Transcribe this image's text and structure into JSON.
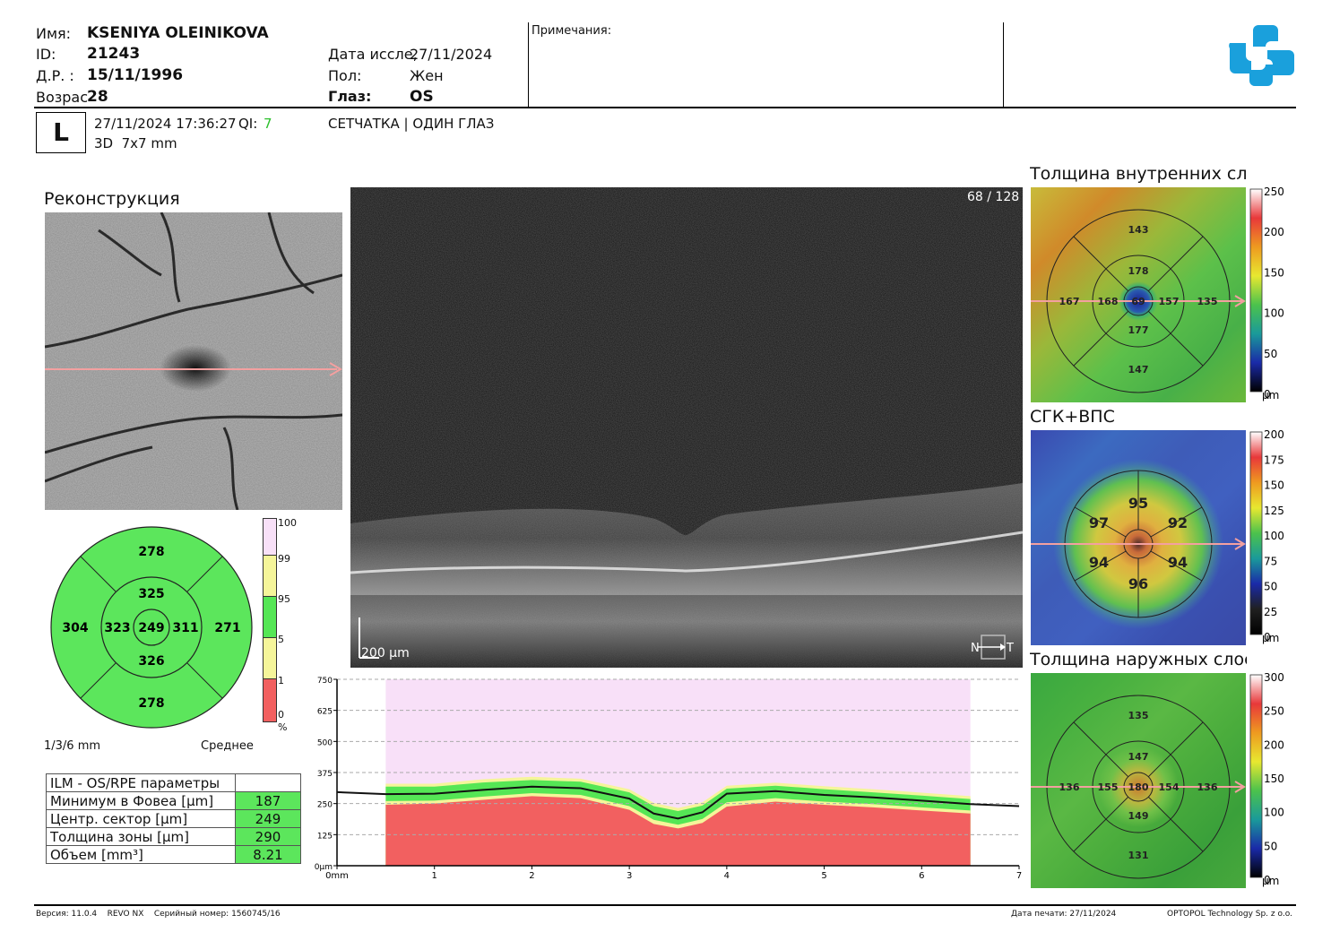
{
  "patient": {
    "name_label": "Имя:",
    "name": "KSENIYA OLEINIKOVA",
    "id_label": "ID:",
    "id": "21243",
    "dob_label": "Д.Р. :",
    "dob": "15/11/1996",
    "age_label": "Возрас",
    "age": "28",
    "exam_label": "Дата иссле,",
    "exam_date": "27/11/2024",
    "sex_label": "Пол:",
    "sex": "Жен",
    "eye_label": "Глаз:",
    "eye": "OS",
    "notes_label": "Примечания:"
  },
  "scan": {
    "eye_letter": "L",
    "datetime": "27/11/2024 17:36:27",
    "qi_label": "QI:",
    "qi_value": "7",
    "protocol": "3D  7x7 mm",
    "mode": "СЕТЧАТКА | ОДИН ГЛАЗ"
  },
  "reconstruction": {
    "title": "Реконструкция"
  },
  "bscan": {
    "slice": "68 / 128",
    "scalebar": "200 µm",
    "n": "N",
    "t": "T"
  },
  "etdrs": {
    "values": {
      "outer_top": "278",
      "outer_left": "304",
      "outer_right": "271",
      "outer_bottom": "278",
      "inner_top": "325",
      "inner_left": "323",
      "inner_right": "311",
      "inner_bottom": "326",
      "center": "249"
    },
    "grid_label": "1/3/6 mm",
    "mode_label": "Среднее",
    "scale": [
      "100",
      "99",
      "95",
      "5",
      "1",
      "0"
    ],
    "scale_unit": "%"
  },
  "params": {
    "header": "ILM - OS/RPE параметры",
    "rows": [
      {
        "label": "Минимум в Фовеа [µm]",
        "value": "187"
      },
      {
        "label": "Центр. сектор [µm]",
        "value": "249"
      },
      {
        "label": "Толщина зоны [µm]",
        "value": "290"
      },
      {
        "label": "Объем [mm³]",
        "value": "8.21"
      }
    ]
  },
  "chart_data": {
    "type": "area",
    "yticks": [
      "750",
      "625",
      "500",
      "375",
      "250",
      "125",
      "0µm"
    ],
    "xticks": [
      "0mm",
      "1",
      "2",
      "3",
      "4",
      "5",
      "6",
      "7"
    ],
    "ylim": [
      0,
      750
    ],
    "xlim": [
      0,
      7
    ],
    "x": [
      0,
      0.5,
      1,
      1.5,
      2,
      2.5,
      3,
      3.25,
      3.5,
      3.75,
      4,
      4.5,
      5,
      5.5,
      6,
      6.5,
      7
    ],
    "thickness": [
      296,
      288,
      290,
      305,
      318,
      312,
      270,
      210,
      190,
      215,
      290,
      300,
      285,
      275,
      262,
      248,
      240
    ],
    "normal_bands": [
      {
        "name": "0-1%",
        "color": "#f26060",
        "values": [
          0,
          245,
          250,
          265,
          280,
          272,
          225,
          168,
          150,
          172,
          238,
          258,
          245,
          235,
          222,
          210,
          0
        ]
      },
      {
        "name": "1-5%",
        "color": "#f5f59a",
        "values": [
          0,
          260,
          262,
          278,
          292,
          285,
          240,
          185,
          165,
          188,
          255,
          272,
          258,
          248,
          235,
          222,
          0
        ]
      },
      {
        "name": "5-95%",
        "color": "#55e655",
        "values": [
          0,
          318,
          318,
          335,
          345,
          338,
          295,
          240,
          220,
          242,
          310,
          322,
          308,
          295,
          282,
          268,
          0
        ]
      },
      {
        "name": "95-99%",
        "color": "#f5f59a",
        "values": [
          0,
          330,
          330,
          348,
          358,
          350,
          308,
          253,
          232,
          255,
          322,
          334,
          320,
          308,
          294,
          280,
          0
        ]
      },
      {
        "name": "99-100%",
        "color": "#f8e0f8",
        "values": [
          0,
          750,
          750,
          750,
          750,
          750,
          750,
          750,
          750,
          750,
          750,
          750,
          750,
          750,
          750,
          750,
          0
        ]
      }
    ]
  },
  "maps": {
    "inner": {
      "title": "Толщина внутренних сло",
      "values": {
        "outer_top": "143",
        "outer_left": "167",
        "outer_right": "135",
        "outer_bottom": "147",
        "inner_top": "178",
        "inner_left": "168",
        "inner_right": "157",
        "inner_bottom": "177",
        "center": "69"
      },
      "scale": [
        "250",
        "200",
        "150",
        "100",
        "50",
        "0"
      ],
      "unit": "µm"
    },
    "gcl": {
      "title": "СГК+ВПС",
      "values": {
        "top": "95",
        "left_top": "97",
        "right_top": "92",
        "left_bottom": "94",
        "right_bottom": "94",
        "bottom": "96"
      },
      "scale": [
        "200",
        "175",
        "150",
        "125",
        "100",
        "75",
        "50",
        "25",
        "0"
      ],
      "unit": "µm"
    },
    "outer": {
      "title": "Толщина наружных слое",
      "values": {
        "outer_top": "135",
        "outer_left": "136",
        "outer_right": "136",
        "outer_bottom": "131",
        "inner_top": "147",
        "inner_left": "155",
        "inner_right": "154",
        "inner_bottom": "149",
        "center": "180"
      },
      "scale": [
        "300",
        "250",
        "200",
        "150",
        "100",
        "50",
        "0"
      ],
      "unit": "µm"
    }
  },
  "footer": {
    "version": "Версия: 11.0.4    REVO NX    Серийный номер: 1560745/16",
    "print_date": "Дата печати: 27/11/2024",
    "company": "OPTOPOL Technology Sp. z o.o."
  }
}
